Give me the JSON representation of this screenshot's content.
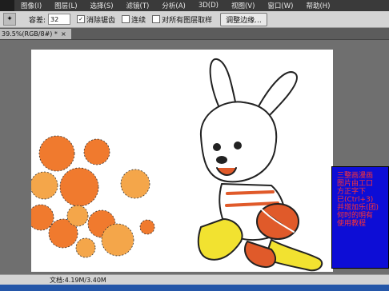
{
  "menubar": {
    "items": [
      "图像(I)",
      "图层(L)",
      "选择(S)",
      "滤镜(T)",
      "分析(A)",
      "3D(D)",
      "视图(V)",
      "窗口(W)",
      "帮助(H)"
    ]
  },
  "options": {
    "feather_label": "容差:",
    "feather_value": "32",
    "antialias_label": "消除锯齿",
    "contiguous_label": "连续",
    "all_layers_label": "对所有图层取样",
    "refine_edge_label": "调整边缘..."
  },
  "document": {
    "tab_label": "39.5%(RGB/8#) *",
    "tab_close": "×"
  },
  "status": {
    "doc_size": "文档:4.19M/3.40M"
  },
  "overlay": {
    "lines": [
      "三整画漫画",
      "图片由工口",
      "方正字下",
      "已(Ctrl+3)",
      "并增加乐(团)",
      "何时的明有",
      "使用教程"
    ]
  },
  "colors": {
    "overlay_bg": "#0d0dd6",
    "overlay_text": "#ff3333",
    "circle_orange": "#f07a2e",
    "circle_light": "#f4a64a"
  },
  "icons": {
    "tool": "magic-wand-icon",
    "close": "close-icon"
  }
}
